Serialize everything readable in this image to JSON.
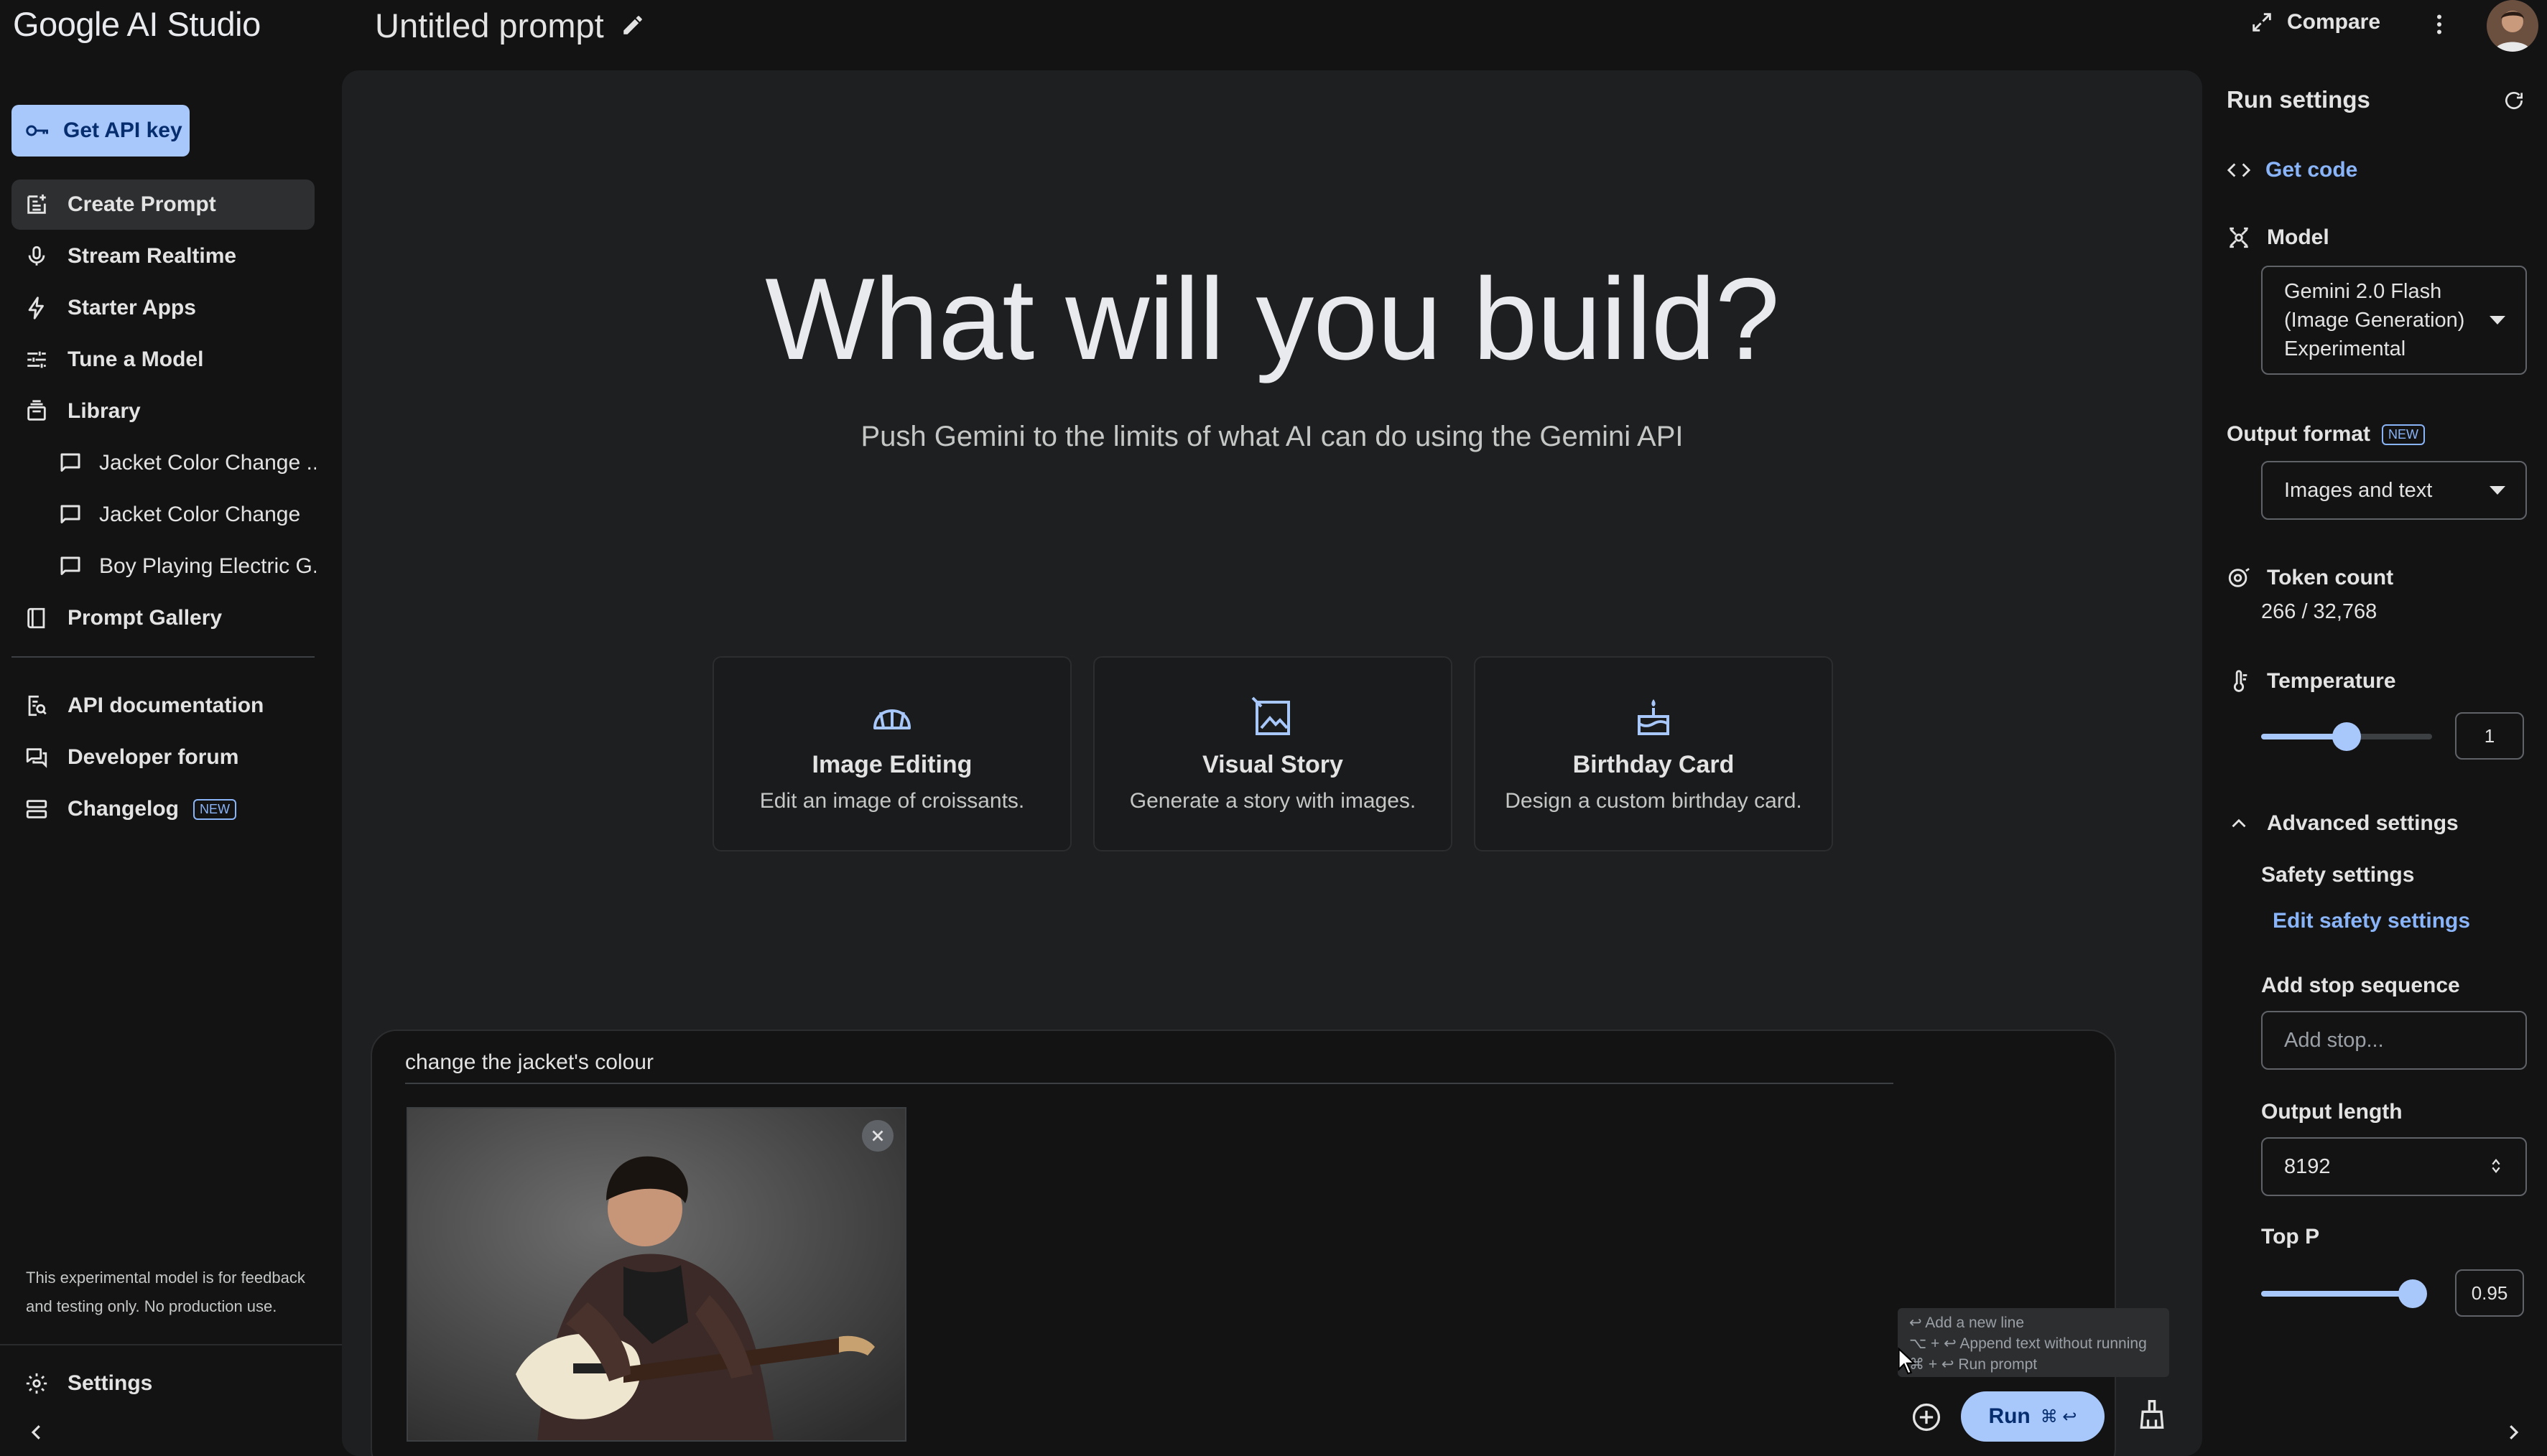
{
  "app": {
    "logo": "Google AI Studio",
    "prompt_title": "Untitled prompt",
    "compare_label": "Compare"
  },
  "sidebar": {
    "api_key_label": "Get API key",
    "items": [
      {
        "label": "Create Prompt",
        "icon": "create-prompt-icon"
      },
      {
        "label": "Stream Realtime",
        "icon": "microphone-icon"
      },
      {
        "label": "Starter Apps",
        "icon": "bolt-icon"
      },
      {
        "label": "Tune a Model",
        "icon": "tune-icon"
      },
      {
        "label": "Library",
        "icon": "library-icon"
      }
    ],
    "library_items": [
      {
        "label": "Jacket Color Change ..."
      },
      {
        "label": "Jacket Color Change"
      },
      {
        "label": "Boy Playing Electric G..."
      }
    ],
    "prompt_gallery": "Prompt Gallery",
    "links": [
      {
        "label": "API documentation"
      },
      {
        "label": "Developer forum"
      },
      {
        "label": "Changelog",
        "badge": "NEW"
      }
    ],
    "disclaimer": "This experimental model is for feedback and testing only. No production use.",
    "settings_label": "Settings"
  },
  "main": {
    "hero_title": "What will you build?",
    "hero_subtitle": "Push Gemini to the limits of what AI can do using the Gemini API",
    "cards": [
      {
        "title": "Image Editing",
        "desc": "Edit an image of croissants.",
        "icon": "croissant-icon"
      },
      {
        "title": "Visual Story",
        "desc": "Generate a story with images.",
        "icon": "story-image-icon"
      },
      {
        "title": "Birthday Card",
        "desc": "Design a custom birthday card.",
        "icon": "cake-icon"
      }
    ],
    "prompt_value": "change the jacket's colour",
    "tooltip": {
      "line1": "↩ Add a new line",
      "line2": "⌥ + ↩ Append text without running",
      "line3": "⌘ + ↩ Run prompt"
    },
    "run_label": "Run",
    "run_shortcut": "⌘ ↩"
  },
  "run_settings": {
    "title": "Run settings",
    "get_code": "Get code",
    "model_label": "Model",
    "model_value": "Gemini 2.0 Flash (Image Generation) Experimental",
    "output_format_label": "Output format",
    "output_format_badge": "NEW",
    "output_format_value": "Images and text",
    "token_count_label": "Token count",
    "token_count_value": "266 / 32,768",
    "temperature_label": "Temperature",
    "temperature_value": "1",
    "temperature_fraction": 0.5,
    "advanced_label": "Advanced settings",
    "safety_label": "Safety settings",
    "safety_link": "Edit safety settings",
    "stop_label": "Add stop sequence",
    "stop_placeholder": "Add stop...",
    "output_length_label": "Output length",
    "output_length_value": "8192",
    "top_p_label": "Top P",
    "top_p_value": "0.95",
    "top_p_fraction": 0.95
  },
  "colors": {
    "accent": "#a8c7fa",
    "link": "#8ab4f8",
    "background": "#131314",
    "panel": "#1e1f20"
  }
}
